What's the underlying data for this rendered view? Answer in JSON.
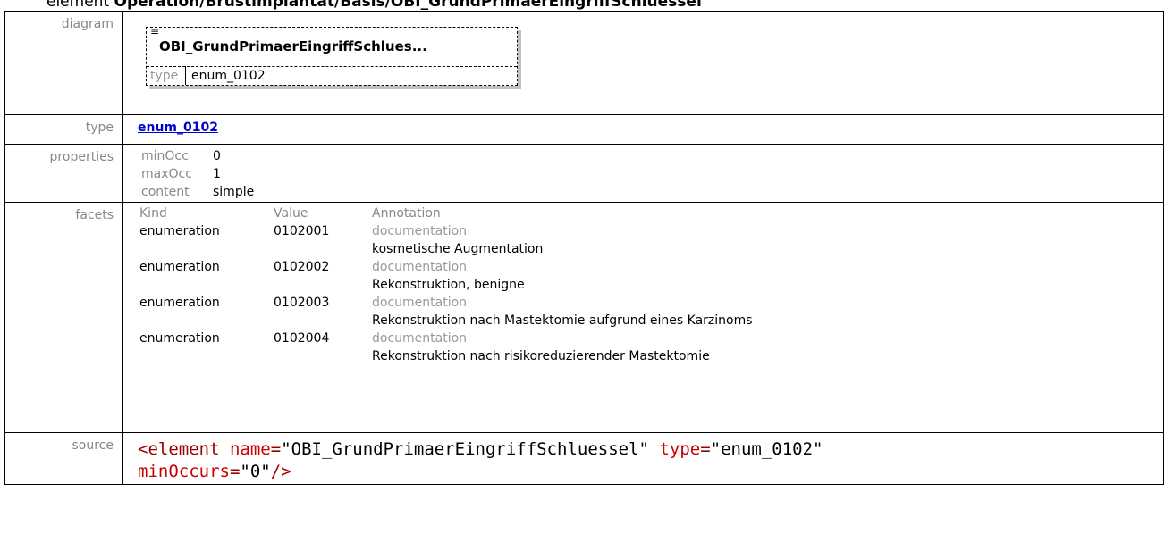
{
  "heading": {
    "prefix": "element",
    "path": "Operation/Brustimplantat/Basis/OBI_GrundPrimaerEingriffSchluessel"
  },
  "labels": {
    "diagram": "diagram",
    "type": "type",
    "properties": "properties",
    "facets": "facets",
    "source": "source"
  },
  "diagram": {
    "name": "OBI_GrundPrimaerEingriffSchlues...",
    "type_label": "type",
    "type_value": "enum_0102"
  },
  "type_link": "enum_0102",
  "properties": [
    {
      "key": "minOcc",
      "value": "0"
    },
    {
      "key": "maxOcc",
      "value": "1"
    },
    {
      "key": "content",
      "value": "simple"
    }
  ],
  "facets": {
    "headers": {
      "kind": "Kind",
      "value": "Value",
      "annotation": "Annotation"
    },
    "doc_label": "documentation",
    "rows": [
      {
        "kind": "enumeration",
        "value": "0102001",
        "doc": "kosmetische Augmentation"
      },
      {
        "kind": "enumeration",
        "value": "0102002",
        "doc": "Rekonstruktion, benigne"
      },
      {
        "kind": "enumeration",
        "value": "0102003",
        "doc": "Rekonstruktion nach Mastektomie aufgrund eines Karzinoms"
      },
      {
        "kind": "enumeration",
        "value": "0102004",
        "doc": "Rekonstruktion nach risikoreduzierender Mastektomie"
      }
    ]
  },
  "source": {
    "tag_open": "<element",
    "attr1": "name",
    "val1": "\"OBI_GrundPrimaerEingriffSchluessel\"",
    "attr2": "type",
    "val2": "\"enum_0102\"",
    "attr3": "minOccurs",
    "val3": "\"0\"",
    "tag_close": "/>",
    "eq": "="
  }
}
